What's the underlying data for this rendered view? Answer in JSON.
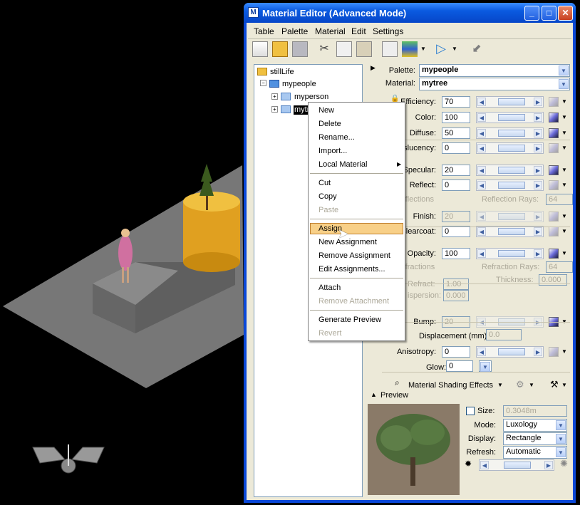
{
  "window": {
    "title": "Material Editor (Advanced Mode)",
    "min": "_",
    "max": "□",
    "close": "✕"
  },
  "menu": [
    "Table",
    "Palette",
    "Material",
    "Edit",
    "Settings"
  ],
  "tree": {
    "root": "stillLife",
    "palette": "mypeople",
    "item1": "myperson",
    "item2": "mytree"
  },
  "context_menu": {
    "new": "New",
    "delete": "Delete",
    "rename": "Rename...",
    "import": "Import...",
    "local": "Local Material",
    "cut": "Cut",
    "copy": "Copy",
    "paste": "Paste",
    "assign": "Assign",
    "new_assign": "New Assignment",
    "remove_assign": "Remove Assignment",
    "edit_assign": "Edit Assignments...",
    "attach": "Attach",
    "remove_attach": "Remove Attachment",
    "gen_preview": "Generate Preview",
    "revert": "Revert"
  },
  "props": {
    "palette_label": "Palette:",
    "palette_value": "mypeople",
    "material_label": "Material:",
    "material_value": "mytree",
    "efficiency_label": "Efficiency:",
    "efficiency": "70",
    "color_label": "Color:",
    "color": "100",
    "diffuse_label": "Diffuse:",
    "diffuse": "50",
    "translucency_label": "slucency:",
    "translucency": "0",
    "specular_label": "Specular:",
    "specular": "20",
    "reflect_label": "Reflect:",
    "reflect": "0",
    "blur_reflections": "Blur Reflections",
    "reflection_rays_label": "Reflection Rays:",
    "reflection_rays": "64",
    "finish_label": "Finish:",
    "finish": "20",
    "clearcoat_label": "Clearcoat:",
    "clearcoat": "0",
    "opacity_label": "Opacity:",
    "opacity": "100",
    "blur_refractions": "Blur Refractions",
    "refraction_rays_label": "Refraction Rays:",
    "refraction_rays": "64",
    "refract_label": "Refract:",
    "refract": "1.00",
    "thickness_label": "Thickness:",
    "thickness": "0.000",
    "dispersion_label": "ispersion:",
    "dispersion": "0.000",
    "bump_label": "Bump:",
    "bump": "20",
    "displacement_label": "Displacement (mm):",
    "displacement": "0.0",
    "anisotropy_label": "Anisotropy:",
    "anisotropy": "0",
    "glow_label": "Glow:",
    "glow": "0",
    "effects": "Material Shading Effects"
  },
  "preview": {
    "header": "Preview",
    "size_label": "Size:",
    "size": "0.3048m",
    "mode_label": "Mode:",
    "mode": "Luxology",
    "display_label": "Display:",
    "display": "Rectangle",
    "refresh_label": "Refresh:",
    "refresh": "Automatic"
  },
  "colors": {
    "title": "#0a5ae0",
    "client": "#ece9d8",
    "selection": "#f8d088"
  }
}
